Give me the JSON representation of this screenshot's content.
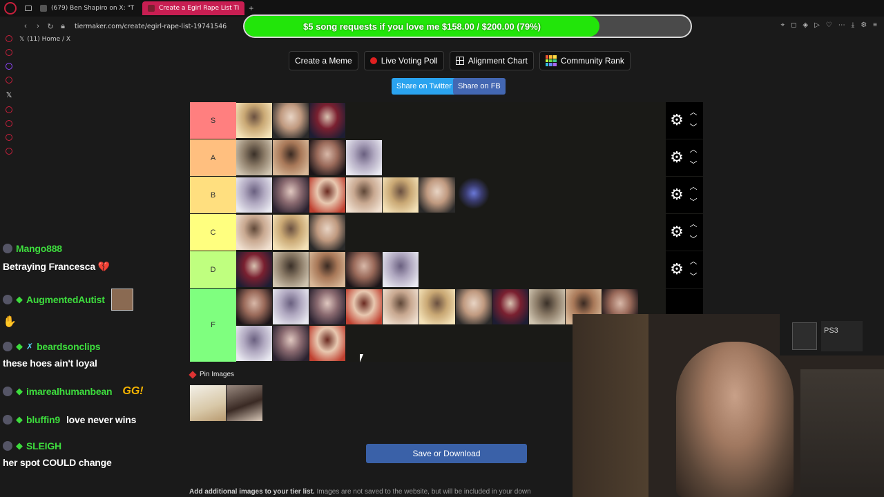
{
  "browser": {
    "tabs": [
      {
        "label": "(679) Ben Shapiro on X: \"T",
        "active": false
      },
      {
        "label": "Create a Egirl Rape List Ti",
        "active": true
      }
    ],
    "url": "tiermaker.com/create/egirl-rape-list-19741546",
    "bookmark": "(11) Home / X"
  },
  "donation": {
    "text": "$5 song requests if you love me $158.00 / $200.00 (79%)",
    "progress": 0.79,
    "color": "#22e50a"
  },
  "toolbar": {
    "create_meme": "Create a Meme",
    "live_voting": "Live Voting Poll",
    "alignment": "Alignment Chart",
    "community": "Community Rank"
  },
  "share": {
    "twitter": "Share on Twitter",
    "facebook": "Share on FB"
  },
  "tiers": [
    {
      "label": "S",
      "color": "#ff7f7f",
      "images": 3
    },
    {
      "label": "A",
      "color": "#ffbf7f",
      "images": 4
    },
    {
      "label": "B",
      "color": "#ffdf7f",
      "images": 7
    },
    {
      "label": "C",
      "color": "#ffff7f",
      "images": 3
    },
    {
      "label": "D",
      "color": "#bfff7f",
      "images": 5
    },
    {
      "label": "F",
      "color": "#7fff7f",
      "images": 14
    }
  ],
  "pin": {
    "label": "Pin Images",
    "images": 2
  },
  "save_button": "Save or Download",
  "footnote": {
    "bold": "Add additional images to your tier list.",
    "rest": " Images are not saved to the website, but will be included in your down"
  },
  "chat": [
    {
      "user": "Mango888",
      "text": "Betraying Francesca 💔"
    },
    {
      "user": "AugmentedAutist",
      "text": ""
    },
    {
      "user": "beardsonclips",
      "text": "these hoes ain't loyal"
    },
    {
      "user": "imarealhumanbean",
      "text": ""
    },
    {
      "user": "bluffin9",
      "text": "love never wins"
    },
    {
      "user": "SLEIGH",
      "text": "her spot COULD change"
    }
  ]
}
